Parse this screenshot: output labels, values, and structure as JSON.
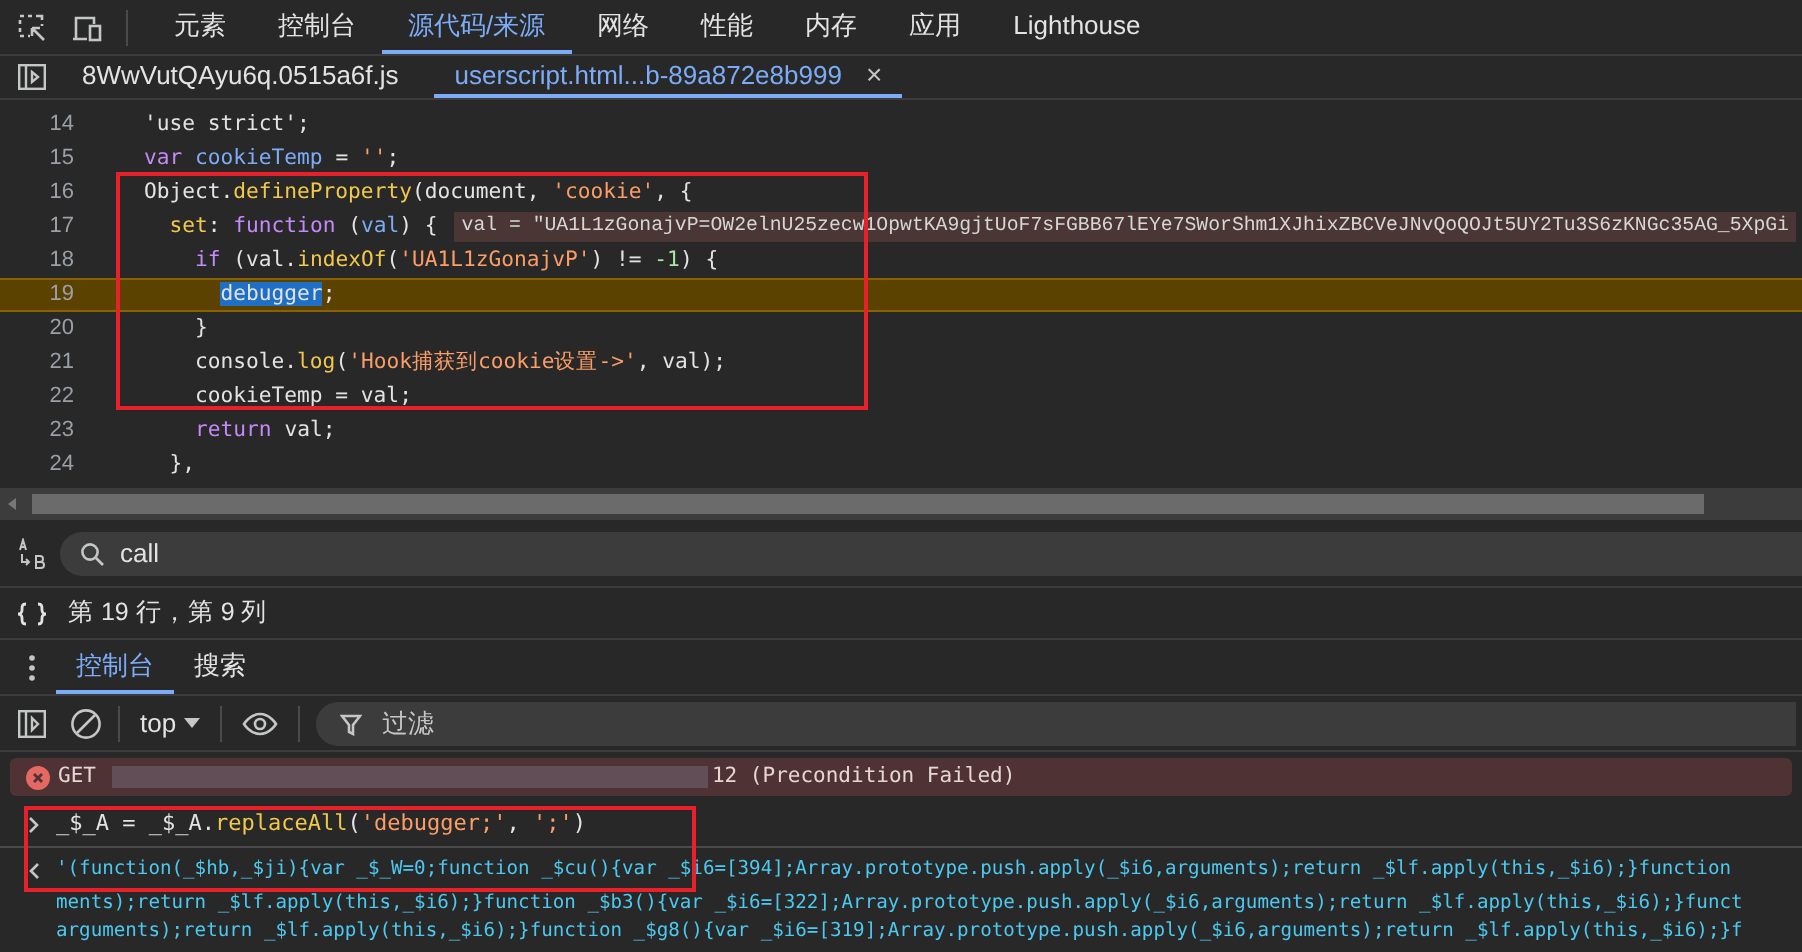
{
  "main_tabs": [
    {
      "label": "元素",
      "selected": false
    },
    {
      "label": "控制台",
      "selected": false
    },
    {
      "label": "源代码/来源",
      "selected": true
    },
    {
      "label": "网络",
      "selected": false
    },
    {
      "label": "性能",
      "selected": false
    },
    {
      "label": "内存",
      "selected": false
    },
    {
      "label": "应用",
      "selected": false
    },
    {
      "label": "Lighthouse",
      "selected": false
    }
  ],
  "file_tabs": [
    {
      "label": "8WwVutQAyu6q.0515a6f.js",
      "selected": false
    },
    {
      "label": "userscript.html...b-89a872e8b999",
      "selected": true,
      "close": "×"
    }
  ],
  "code_lines": [
    {
      "number": "14",
      "paused": false,
      "tokens": [
        {
          "kind": "plain",
          "text": "'use strict'"
        },
        {
          "kind": "plain",
          "text": ";"
        }
      ]
    },
    {
      "number": "15",
      "paused": false,
      "tokens": [
        {
          "kind": "keyword",
          "text": "var"
        },
        {
          "kind": "variable",
          "text": " cookieTemp"
        },
        {
          "kind": "plain",
          "text": " = "
        },
        {
          "kind": "string",
          "text": "''"
        },
        {
          "kind": "plain",
          "text": ";"
        }
      ]
    },
    {
      "number": "16",
      "paused": false,
      "tokens": [
        {
          "kind": "plain",
          "text": "Object."
        },
        {
          "kind": "function",
          "text": "defineProperty"
        },
        {
          "kind": "plain",
          "text": "(document, "
        },
        {
          "kind": "string",
          "text": "'cookie'"
        },
        {
          "kind": "plain",
          "text": ", {"
        }
      ]
    },
    {
      "number": "17",
      "paused": false,
      "inline_value": "val = \"UA1L1zGonajvP=OW2elnU25zecw1OpwtKA9gjtUoF7sFGBB67lEYe7SWorShm1XJhixZBCVeJNvQoQOJt5UY2Tu3S6zKNGc35AG_5XpGi",
      "tokens": [
        {
          "kind": "function",
          "text": "  set"
        },
        {
          "kind": "plain",
          "text": ": "
        },
        {
          "kind": "keyword",
          "text": "function"
        },
        {
          "kind": "plain",
          "text": " ("
        },
        {
          "kind": "variable",
          "text": "val"
        },
        {
          "kind": "plain",
          "text": ") {"
        }
      ]
    },
    {
      "number": "18",
      "paused": false,
      "tokens": [
        {
          "kind": "keyword",
          "text": "    if"
        },
        {
          "kind": "plain",
          "text": " (val."
        },
        {
          "kind": "function",
          "text": "indexOf"
        },
        {
          "kind": "plain",
          "text": "("
        },
        {
          "kind": "string",
          "text": "'UA1L1zGonajvP'"
        },
        {
          "kind": "plain",
          "text": ") != "
        },
        {
          "kind": "number",
          "text": "-1"
        },
        {
          "kind": "plain",
          "text": ") {"
        }
      ]
    },
    {
      "number": "19",
      "paused": true,
      "tokens": [
        {
          "kind": "selection",
          "text": "      debugger"
        },
        {
          "kind": "plain",
          "text": ";"
        }
      ]
    },
    {
      "number": "20",
      "paused": false,
      "tokens": [
        {
          "kind": "plain",
          "text": "    }"
        }
      ]
    },
    {
      "number": "21",
      "paused": false,
      "tokens": [
        {
          "kind": "plain",
          "text": "    console."
        },
        {
          "kind": "function",
          "text": "log"
        },
        {
          "kind": "plain",
          "text": "("
        },
        {
          "kind": "string",
          "text": "'Hook捕获到cookie设置->'"
        },
        {
          "kind": "plain",
          "text": ", val);"
        }
      ]
    },
    {
      "number": "22",
      "paused": false,
      "tokens": [
        {
          "kind": "plain",
          "text": "    cookieTemp = val;"
        }
      ]
    },
    {
      "number": "23",
      "paused": false,
      "tokens": [
        {
          "kind": "keyword",
          "text": "    return"
        },
        {
          "kind": "plain",
          "text": " val;"
        }
      ]
    },
    {
      "number": "24",
      "paused": false,
      "tokens": [
        {
          "kind": "plain",
          "text": "  },"
        }
      ]
    }
  ],
  "search": {
    "value": "call"
  },
  "status": "第 19 行，第 9 列",
  "drawer_tabs": [
    {
      "label": "控制台",
      "selected": true
    },
    {
      "label": "搜索",
      "selected": false
    }
  ],
  "console_toolbar": {
    "context": "top",
    "filter_placeholder": "过滤"
  },
  "console": {
    "error": {
      "method": "GET",
      "message": "12 (Precondition Failed)"
    },
    "input": [
      {
        "kind": "plain",
        "text": "_$_A = _$_A."
      },
      {
        "kind": "function",
        "text": "replaceAll"
      },
      {
        "kind": "plain",
        "text": "("
      },
      {
        "kind": "string",
        "text": "'debugger;'"
      },
      {
        "kind": "plain",
        "text": ", "
      },
      {
        "kind": "string",
        "text": "';'"
      },
      {
        "kind": "plain",
        "text": ")"
      }
    ],
    "output": [
      "'(function(_$hb,_$ji){var _$_W=0;function _$cu(){var _$i6=[394];Array.prototype.push.apply(_$i6,arguments);return _$lf.apply(this,_$i6);}function",
      "ments);return _$lf.apply(this,_$i6);}function _$b3(){var _$i6=[322];Array.prototype.push.apply(_$i6,arguments);return _$lf.apply(this,_$i6);}funct",
      "arguments);return _$lf.apply(this,_$i6);}function _$g8(){var _$i6=[319];Array.prototype.push.apply(_$i6,arguments);return _$lf.apply(this,_$i6);}f"
    ]
  }
}
